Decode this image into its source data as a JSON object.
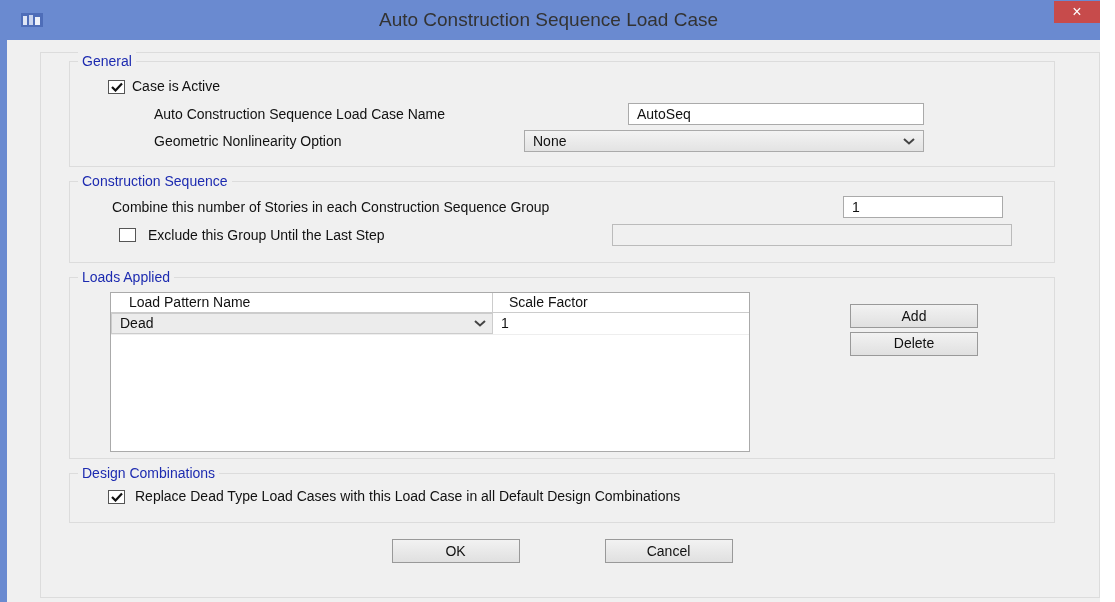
{
  "window": {
    "title": "Auto Construction Sequence Load Case",
    "close": "×"
  },
  "general": {
    "legend": "General",
    "case_active": {
      "label": "Case is Active",
      "checked": true
    },
    "name_label": "Auto Construction Sequence Load Case Name",
    "name_value": "AutoSeq",
    "nonlinearity_label": "Geometric Nonlinearity Option",
    "nonlinearity_value": "None"
  },
  "construction": {
    "legend": "Construction Sequence",
    "combine_label": "Combine this number of Stories in each Construction Sequence Group",
    "combine_value": "1",
    "exclude": {
      "label": "Exclude this Group Until the Last Step",
      "checked": false
    },
    "group_field": {
      "disabled": true
    }
  },
  "loads": {
    "legend": "Loads Applied",
    "columns": [
      "Load Pattern Name",
      "Scale Factor"
    ],
    "rows": [
      {
        "pattern": "Dead",
        "scale": "1"
      }
    ],
    "buttons": [
      "Add",
      "Delete"
    ]
  },
  "design": {
    "legend": "Design Combinations",
    "replace": {
      "label": "Replace Dead Type Load Cases with this Load Case in all Default Design Combinations",
      "checked": true
    }
  },
  "buttons": [
    "OK",
    "Cancel"
  ]
}
